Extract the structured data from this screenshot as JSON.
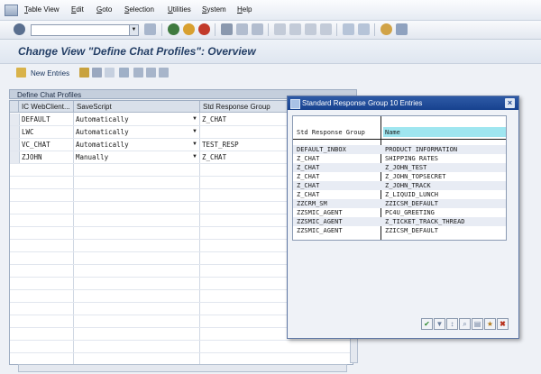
{
  "menu": {
    "items": [
      "Table View",
      "Edit",
      "Goto",
      "Selection",
      "Utilities",
      "System",
      "Help"
    ]
  },
  "toolbar": {
    "command_field_value": "",
    "icons": [
      "enter-icon",
      "save-icon",
      "back-icon",
      "exit-icon",
      "cancel-icon",
      "print-icon",
      "find-icon",
      "find-next-icon",
      "first-page-icon",
      "previous-page-icon",
      "next-page-icon",
      "last-page-icon",
      "create-session-icon",
      "shortcut-icon",
      "help-icon",
      "customize-layout-icon"
    ]
  },
  "page": {
    "title": "Change View \"Define Chat Profiles\": Overview"
  },
  "app_toolbar": {
    "new_entries_label": "New Entries",
    "icons": [
      "other-entry-icon",
      "copy-icon",
      "delete-icon",
      "undo-icon",
      "select-all-icon",
      "select-block-icon",
      "deselect-all-icon"
    ]
  },
  "main_table": {
    "title": "Define Chat Profiles",
    "columns": [
      "IC WebClient...",
      "SaveScript",
      "Std Response Group"
    ],
    "rows": [
      {
        "profile": "DEFAULT",
        "savescript": "Automatically",
        "group": "Z_CHAT"
      },
      {
        "profile": "LWC",
        "savescript": "Automatically",
        "group": ""
      },
      {
        "profile": "VC_CHAT",
        "savescript": "Automatically",
        "group": "TEST_RESP"
      },
      {
        "profile": "ZJOHN",
        "savescript": "Manually",
        "group": "Z_CHAT"
      }
    ]
  },
  "popup": {
    "title": "Standard Response Group   10 Entries",
    "columns": [
      "Std Response Group",
      "Name"
    ],
    "rows": [
      {
        "group": "DEFAULT_INBOX",
        "name": "PRODUCT INFORMATION"
      },
      {
        "group": "Z_CHAT",
        "name": "SHIPPING RATES"
      },
      {
        "group": "Z_CHAT",
        "name": "Z_JOHN_TEST"
      },
      {
        "group": "Z_CHAT",
        "name": "Z_JOHN_TOPSECRET"
      },
      {
        "group": "Z_CHAT",
        "name": "Z_JOHN_TRACK"
      },
      {
        "group": "Z_CHAT",
        "name": "Z_LIQUID_LUNCH"
      },
      {
        "group": "ZZCRM_SM",
        "name": "ZZICSM_DEFAULT"
      },
      {
        "group": "ZZSMIC_AGENT",
        "name": "PC4U_GREETING"
      },
      {
        "group": "ZZSMIC_AGENT",
        "name": "Z_TICKET_TRACK_THREAD"
      },
      {
        "group": "ZZSMIC_AGENT",
        "name": "ZZICSM_DEFAULT"
      }
    ],
    "buttons": [
      "continue-icon",
      "filter-icon",
      "sort-icon",
      "find-icon",
      "print-icon",
      "own-values-icon",
      "cancel-icon"
    ]
  },
  "colors": {
    "title_text": "#243f66",
    "popup_titlebar": "#1e4c9a",
    "list_header_highlight": "#9fe6f0"
  }
}
